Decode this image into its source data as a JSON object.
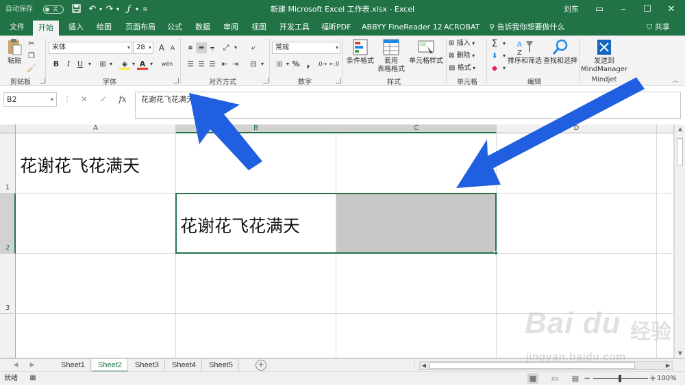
{
  "titlebar": {
    "autosave": "自动保存",
    "toggle": "关",
    "title": "新建 Microsoft Excel 工作表.xlsx - Excel",
    "user": "刘东"
  },
  "tabs": [
    "文件",
    "开始",
    "插入",
    "绘图",
    "页面布局",
    "公式",
    "数据",
    "审阅",
    "视图",
    "开发工具",
    "福昕PDF",
    "ABBYY FineReader 12",
    "ACROBAT",
    "告诉我你想要做什么"
  ],
  "share": "共享",
  "ribbon": {
    "clipboard": {
      "paste": "粘贴",
      "label": "剪贴板"
    },
    "font": {
      "name": "宋体",
      "size": "28",
      "bold": "B",
      "italic": "I",
      "underline": "U",
      "label": "字体",
      "increase": "A",
      "decrease": "A",
      "wen": "wén"
    },
    "alignment": {
      "label": "对齐方式"
    },
    "number": {
      "format": "常规",
      "label": "数字",
      "percent": "%",
      "comma": ","
    },
    "styles": {
      "conditional": "条件格式",
      "table_line1": "套用",
      "table_line2": "表格格式",
      "cell_styles": "单元格样式",
      "label": "样式"
    },
    "cells": {
      "insert": "插入",
      "delete": "删除",
      "format": "格式",
      "label": "单元格"
    },
    "editing": {
      "sort": "排序和筛选",
      "find": "查找和选择",
      "label": "编辑"
    },
    "mindjet": {
      "line1": "发送到",
      "line2": "MindManager",
      "label": "Mindjet"
    }
  },
  "formula_bar": {
    "name_box": "B2",
    "content": "花谢花飞花满天"
  },
  "grid": {
    "columns": [
      "A",
      "B",
      "C",
      "D"
    ],
    "rows": [
      "1",
      "2",
      "3"
    ],
    "a1": "花谢花飞花满天",
    "b2": "花谢花飞花满天",
    "c2_fill": "#c8c8c8"
  },
  "sheets": [
    "Sheet1",
    "Sheet2",
    "Sheet3",
    "Sheet4",
    "Sheet5"
  ],
  "active_sheet": "Sheet2",
  "status": {
    "ready": "就绪",
    "zoom": "100%",
    "zoom_percent": 100
  },
  "watermark": {
    "logo": "Bai du",
    "cn": "经验",
    "url": "jingyan.baidu.com"
  },
  "colors": {
    "excel_green": "#217346",
    "arrow_blue": "#1f5fe0"
  }
}
